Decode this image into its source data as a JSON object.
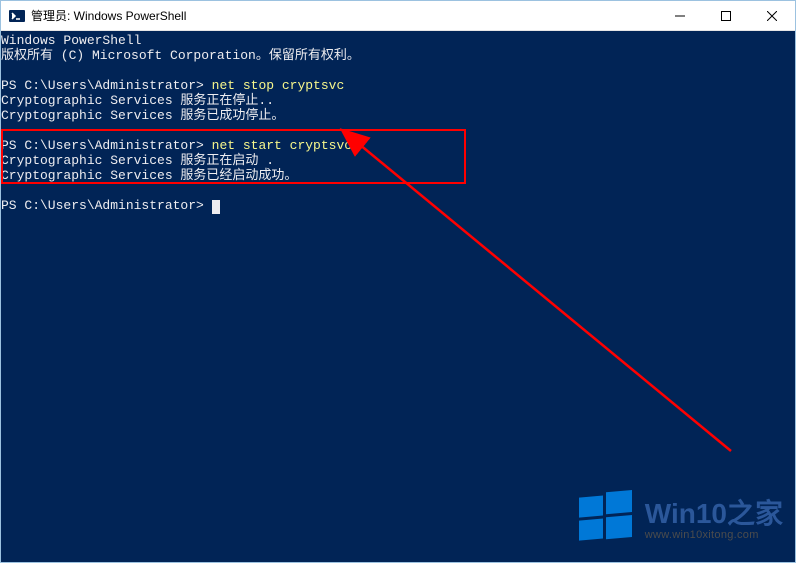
{
  "titlebar": {
    "title": "管理员: Windows PowerShell"
  },
  "terminal": {
    "header1": "Windows PowerShell",
    "header2": "版权所有 (C) Microsoft Corporation。保留所有权利。",
    "prompt1": "PS C:\\Users\\Administrator> ",
    "cmd1": "net stop cryptsvc",
    "out1a": "Cryptographic Services 服务正在停止..",
    "out1b": "Cryptographic Services 服务已成功停止。",
    "prompt2": "PS C:\\Users\\Administrator> ",
    "cmd2": "net start cryptsvc",
    "out2a": "Cryptographic Services 服务正在启动 .",
    "out2b": "Cryptographic Services 服务已经启动成功。",
    "prompt3": "PS C:\\Users\\Administrator> "
  },
  "watermark": {
    "title": "Win10之家",
    "url": "www.win10xitong.com"
  }
}
